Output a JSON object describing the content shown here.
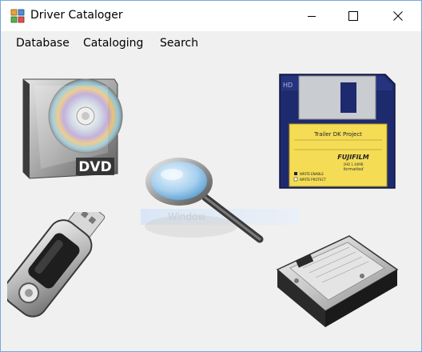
{
  "window": {
    "title": "Driver Cataloger",
    "minimize_icon": "minimize-icon",
    "maximize_icon": "maximize-icon",
    "close_icon": "close-icon"
  },
  "menu": {
    "items": [
      {
        "label": "Database"
      },
      {
        "label": "Cataloging"
      },
      {
        "label": "Search"
      }
    ]
  },
  "images": {
    "dvd_label": "DVD",
    "floppy_label_text": "Trailer DK Project",
    "floppy_brand": "FUJIFILM",
    "floppy_brand_sub": "formatted",
    "floppy_capacity": "2HD 1.44MB",
    "floppy_hd": "HD",
    "floppy_write_enable": "WRITE ENABLE",
    "floppy_write_protect": "WRITE PROTECT",
    "watermark_text": "Window"
  },
  "colors": {
    "title_bg": "#ffffff",
    "client_bg": "#f0f0f0",
    "window_border": "#7aa7d8",
    "floppy_body": "#1e2a6e",
    "floppy_label": "#f4dc55"
  }
}
